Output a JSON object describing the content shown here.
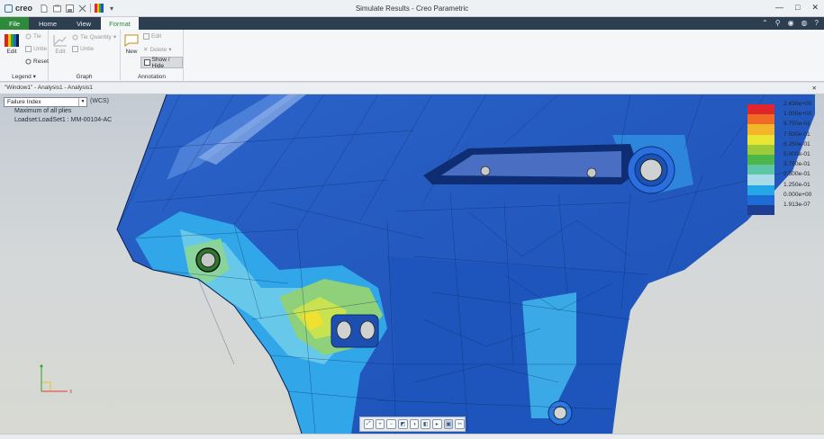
{
  "app": {
    "logo_text": "creo",
    "title": "Simulate Results - Creo Parametric"
  },
  "window_controls": [
    "—",
    "□",
    "✕"
  ],
  "ribbon": {
    "tabs": [
      {
        "label": "File"
      },
      {
        "label": "Home"
      },
      {
        "label": "View"
      },
      {
        "label": "Format",
        "active": true
      }
    ],
    "groups": {
      "legend": {
        "label": "Legend",
        "edit": "Edit",
        "tie": "Tie",
        "untie": "Untie",
        "reset": "Reset"
      },
      "graph": {
        "label": "Graph",
        "edit": "Edit",
        "tie_quantity": "Tie Quantity",
        "untie": "Untie"
      },
      "annotation": {
        "label": "Annotation",
        "new": "New",
        "edit": "Edit",
        "delete": "Delete",
        "show_hide": "Show / Hide"
      }
    }
  },
  "window_strip": {
    "title": "\"Window1\" - Analysis1 - Analysis1"
  },
  "viewport": {
    "result_select": "Failure Index",
    "csys": "(WCS)",
    "info_line1": "Maximum of all plies",
    "info_line2": "Loadset:LoadSet1 :  MM-00104-AC"
  },
  "legend": {
    "values": [
      "2.436e+00",
      "1.000e+00",
      "8.750e-01",
      "7.500e-01",
      "6.250e-01",
      "5.000e-01",
      "3.750e-01",
      "2.500e-01",
      "1.250e-01",
      "0.000e+00",
      "1.913e-07"
    ],
    "colors": [
      "#e0262a",
      "#ef6a24",
      "#f3b52a",
      "#e8e534",
      "#9ccb3a",
      "#4cb64a",
      "#5cc6a6",
      "#a7dbe8",
      "#24a7e6",
      "#1e6bd6",
      "#1d3e93"
    ]
  },
  "icons": {
    "qat": [
      "new-icon",
      "open-icon",
      "save-icon",
      "window-icon",
      "regenerate-icon",
      "dropdown-icon"
    ],
    "bottom_toolbar": [
      "refit-icon",
      "zoom-in-icon",
      "zoom-out-icon",
      "repaint-icon",
      "display-style-icon",
      "saved-view-icon",
      "view-manager-icon",
      "spin-center-icon",
      "annotation-display-icon"
    ]
  },
  "triad": {
    "x_label": "X"
  }
}
